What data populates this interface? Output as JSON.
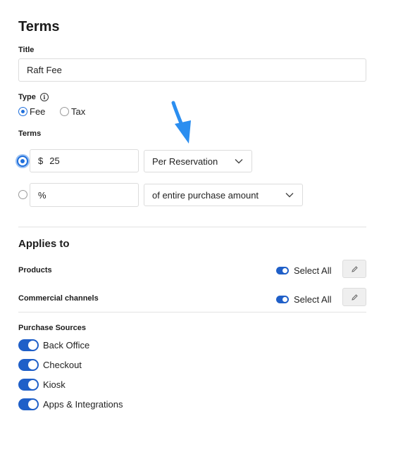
{
  "section_title": "Terms",
  "title_field": {
    "label": "Title",
    "value": "Raft Fee"
  },
  "type": {
    "label": "Type",
    "options": [
      "Fee",
      "Tax"
    ],
    "selected": "Fee"
  },
  "terms": {
    "label": "Terms",
    "amount_row": {
      "currency": "$",
      "value": "25",
      "unit_option": "Per Reservation",
      "selected": true
    },
    "percent_row": {
      "symbol": "%",
      "value": "",
      "unit_option": "of entire purchase amount",
      "selected": false
    }
  },
  "applies_to": {
    "title": "Applies to",
    "rows": [
      {
        "label": "Products",
        "toggle_label": "Select All",
        "on": true
      },
      {
        "label": "Commercial channels",
        "toggle_label": "Select All",
        "on": true
      }
    ]
  },
  "purchase_sources": {
    "label": "Purchase Sources",
    "items": [
      {
        "label": "Back Office",
        "on": true
      },
      {
        "label": "Checkout",
        "on": true
      },
      {
        "label": "Kiosk",
        "on": true
      },
      {
        "label": "Apps & Integrations",
        "on": true
      }
    ]
  },
  "colors": {
    "accent": "#1f5fc8",
    "arrow": "#2b8ef0"
  },
  "icons": [
    "info-icon",
    "chevron-down-icon",
    "pencil-icon",
    "arrow-annotation-icon"
  ]
}
